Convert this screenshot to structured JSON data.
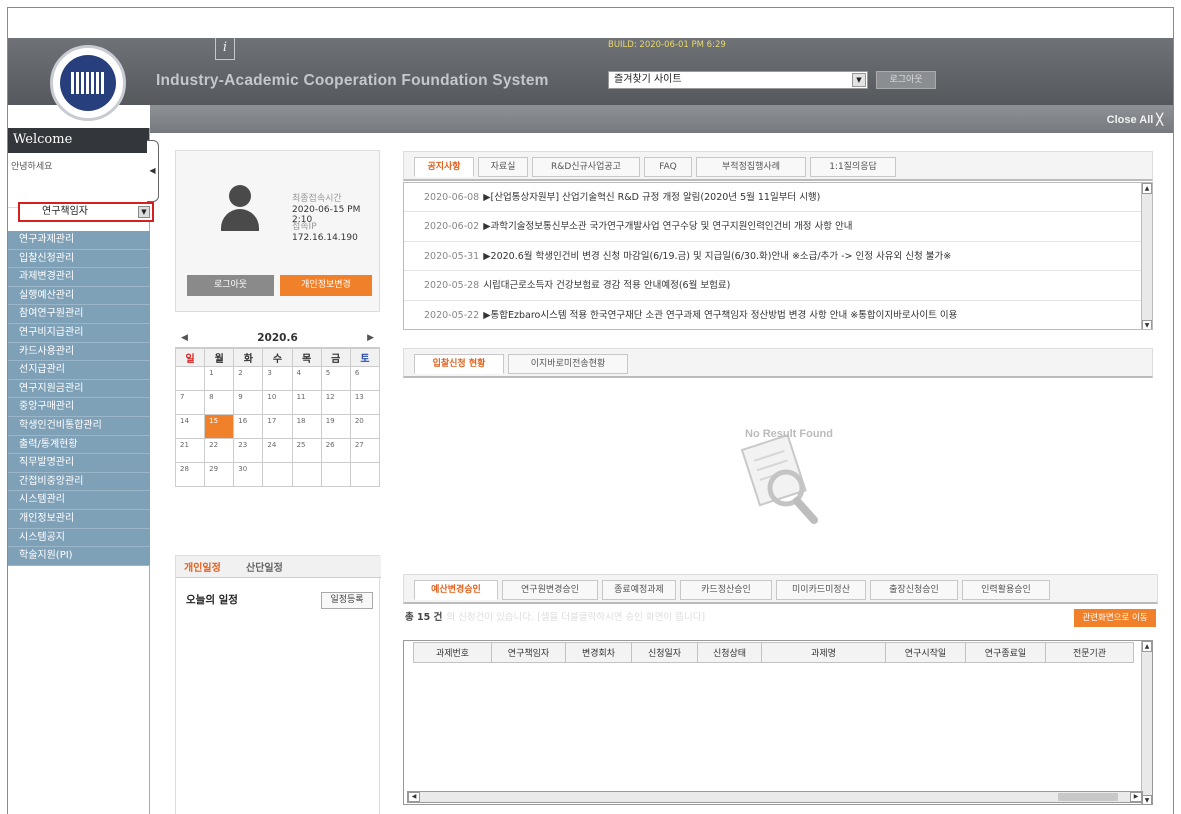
{
  "header": {
    "title": "Industry-Academic Cooperation Foundation System",
    "build": "BUILD: 2020-06-01 PM 6:29",
    "favorites_select": "즐겨찾기 사이트",
    "logout_label": "로그아웃",
    "info_icon": "i",
    "close_all": "Close All ╳"
  },
  "sidebar": {
    "welcome": "Welcome",
    "greeting": "안녕하세요",
    "collapse_icon": "◀",
    "role": "연구책임자",
    "items": [
      "연구과제관리",
      "입찰신청관리",
      "과제변경관리",
      "실행예산관리",
      "참여연구원관리",
      "연구비지급관리",
      "카드사용관리",
      "선지급관리",
      "연구지원금관리",
      "중앙구매관리",
      "학생인건비통합관리",
      "출력/통계현황",
      "직무발명관리",
      "간접비중앙관리",
      "시스템관리",
      "개인정보관리",
      "시스템공지",
      "학술지원(PI)"
    ]
  },
  "profile": {
    "last_login_label": "최종접속시간",
    "last_login_value": "2020-06-15 PM 2:10",
    "ip_label": "접속IP",
    "ip_value": "172.16.14.190",
    "logout_button": "로그아웃",
    "edit_button": "개인정보변경"
  },
  "calendar": {
    "month": "2020.6",
    "prev": "◀",
    "next": "▶",
    "weekdays": [
      "일",
      "월",
      "화",
      "수",
      "목",
      "금",
      "토"
    ],
    "today": 15,
    "weeks": [
      [
        "",
        "1",
        "2",
        "3",
        "4",
        "5",
        "6"
      ],
      [
        "7",
        "8",
        "9",
        "10",
        "11",
        "12",
        "13"
      ],
      [
        "14",
        "15",
        "16",
        "17",
        "18",
        "19",
        "20"
      ],
      [
        "21",
        "22",
        "23",
        "24",
        "25",
        "26",
        "27"
      ],
      [
        "28",
        "29",
        "30",
        "",
        "",
        "",
        ""
      ]
    ]
  },
  "schedule": {
    "tabs": [
      "개인일정",
      "산단일정"
    ],
    "today_label": "오늘의 일정",
    "register_button": "일정등록"
  },
  "notice_tabs": [
    "공지사항",
    "자료실",
    "R&D신규사업공고",
    "FAQ",
    "부적정집행사례",
    "1:1질의응답"
  ],
  "notices": [
    {
      "date": "2020-06-08",
      "text": "▶[산업통상자원부] 산업기술혁신 R&D 규정 개정 알림(2020년 5월 11일부터 시행)"
    },
    {
      "date": "2020-06-02",
      "text": "▶과학기술정보통신부소관 국가연구개발사업 연구수당 및 연구지원인력인건비 개정 사항 안내"
    },
    {
      "date": "2020-05-31",
      "text": "▶2020.6월 학생인건비 변경 신청 마감일(6/19.금) 및 지급일(6/30.화)안내 ※소급/추가 -> 인정 사유외 신청 불가※"
    },
    {
      "date": "2020-05-28",
      "text": "시립대근로소득자 건강보험료 경감 적용 안내예정(6월 보험료)"
    },
    {
      "date": "2020-05-22",
      "text": "▶통합Ezbaro시스템 적용 한국연구재단 소관 연구과제 연구책임자 정산방법 변경 사항 안내    ※통합이지바로사이트 이용"
    }
  ],
  "status_tabs": [
    "입찰신청 현황",
    "이지바로미전송현황"
  ],
  "no_result": "No Result Found",
  "approval_tabs": [
    "예산변경승인",
    "연구원변경승인",
    "종료예정과제",
    "카드정산승인",
    "미이카드미정산",
    "출장신청승인",
    "인력활용승인"
  ],
  "approval_info": {
    "count": "총 15 건",
    "hint": "의 신청건이 있습니다. [셀을 더블클릭하시면 승인 화면이 뜹니다]",
    "go_button": "관련화면으로 이동"
  },
  "approval_table": {
    "columns": [
      "과제번호",
      "연구책임자",
      "변경회차",
      "신청일자",
      "신청상태",
      "과제명",
      "연구시작일",
      "연구종료일",
      "전문기관"
    ]
  }
}
